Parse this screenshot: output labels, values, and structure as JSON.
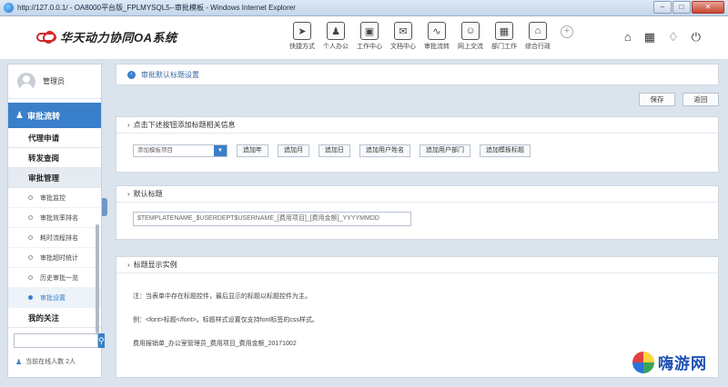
{
  "window": {
    "title": "http://127.0.0.1/ - OA8000平台版_FPLMYSQL5--审批模板 - Windows Internet Explorer",
    "min": "–",
    "max": "□",
    "close": "✕"
  },
  "app": {
    "title": "华天动力协同OA系统"
  },
  "modules": [
    {
      "label": "快捷方式",
      "icon": "➤"
    },
    {
      "label": "个人办公",
      "icon": "♟"
    },
    {
      "label": "工作中心",
      "icon": "▣"
    },
    {
      "label": "文档中心",
      "icon": "✉"
    },
    {
      "label": "审批流转",
      "icon": "∿"
    },
    {
      "label": "网上交流",
      "icon": "☺"
    },
    {
      "label": "部门工作",
      "icon": "▦"
    },
    {
      "label": "综合行政",
      "icon": "⌂"
    }
  ],
  "module_add": "+",
  "header_tools": {
    "home": "⌂",
    "grid": "▦",
    "shirt": "♢",
    "power": "⏻"
  },
  "sidebar": {
    "user": "管理员",
    "section": "审批流转",
    "section_icon": "♟",
    "groups_top": [
      "代理申请",
      "转发查阅",
      "审批管理"
    ],
    "sub_items": [
      "审批监控",
      "审批效率排名",
      "耗时流程排名",
      "审批超时统计",
      "历史审批一览",
      "审批设置"
    ],
    "active_sub_index": 5,
    "groups_bottom": [
      "我的关注"
    ],
    "search_placeholder": "",
    "search_icon": "⚲",
    "online_text": "当前在线人数 2人",
    "online_icon": "♟"
  },
  "main": {
    "breadcrumb": "审批默认标题设置",
    "breadcrumb_icon": "›",
    "save": "保存",
    "back": "返回",
    "panel1": {
      "title": "点击下述按钮添加标题相关信息",
      "select_value": "添加模板项目",
      "select_caret": "▼",
      "buttons": [
        "追加年",
        "追加月",
        "追加日",
        "追加用户姓名",
        "追加用户部门",
        "追加模板标题"
      ]
    },
    "panel2": {
      "title": "默认标题",
      "value": "$TEMPLATENAME_$USERDEPT$USERNAME_[费用项目]_[费用金额]_YYYYMMDD"
    },
    "panel3": {
      "title": "标题显示实例",
      "lines": [
        "注：当表单中存在标题控件，最后显示的标题以标题控件为主。",
        "例：<font>标题</font>。标题样式设置仅支持font标签的css样式。",
        "费用报销单_办公室管理员_费用项目_费用金额_20171002"
      ]
    }
  },
  "watermark": "嗨游网",
  "colors": {
    "accent": "#3a7fc9",
    "brand_red": "#d12a2a"
  }
}
